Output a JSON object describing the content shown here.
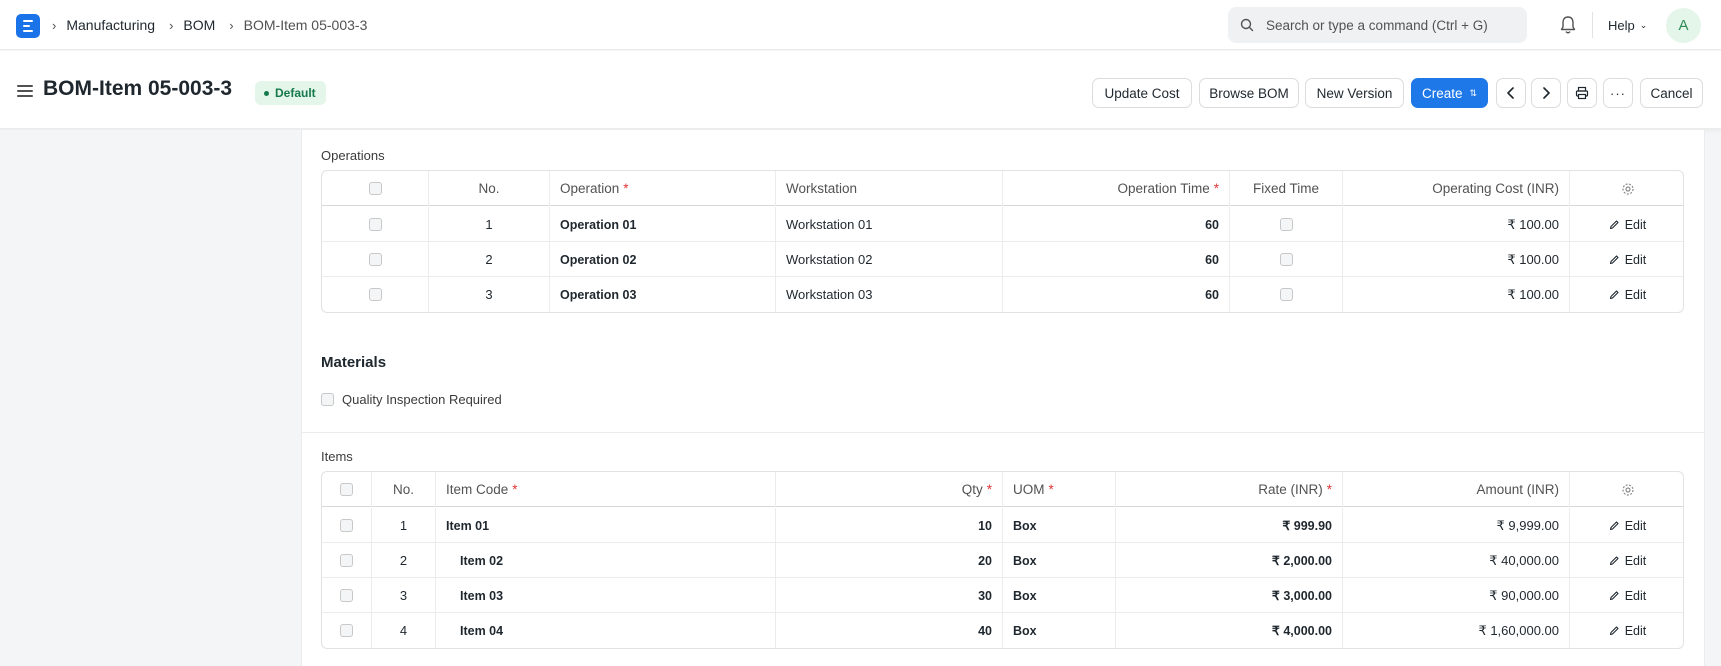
{
  "navbar": {
    "breadcrumbs": [
      "Manufacturing",
      "BOM",
      "BOM-Item 05-003-3"
    ],
    "search_placeholder": "Search or type a command (Ctrl + G)",
    "help_label": "Help",
    "avatar_initial": "A"
  },
  "header": {
    "title": "BOM-Item 05-003-3",
    "status_badge": "Default",
    "buttons": {
      "update_cost": "Update Cost",
      "browse_bom": "Browse BOM",
      "new_version": "New Version",
      "create": "Create",
      "cancel": "Cancel"
    },
    "accent_color": "#1f78e8"
  },
  "operations": {
    "label": "Operations",
    "columns": [
      "No.",
      "Operation",
      "Workstation",
      "Operation Time",
      "Fixed Time",
      "Operating Cost (INR)"
    ],
    "rows": [
      {
        "no": "1",
        "operation": "Operation 01",
        "workstation": "Workstation 01",
        "time": "60",
        "cost": "₹ 100.00"
      },
      {
        "no": "2",
        "operation": "Operation 02",
        "workstation": "Workstation 02",
        "time": "60",
        "cost": "₹ 100.00"
      },
      {
        "no": "3",
        "operation": "Operation 03",
        "workstation": "Workstation 03",
        "time": "60",
        "cost": "₹ 100.00"
      }
    ],
    "edit_label": "Edit"
  },
  "materials": {
    "title": "Materials",
    "quality_inspection_label": "Quality Inspection Required"
  },
  "items": {
    "label": "Items",
    "columns": [
      "No.",
      "Item Code",
      "Qty",
      "UOM",
      "Rate (INR)",
      "Amount (INR)"
    ],
    "rows": [
      {
        "no": "1",
        "code": "Item 01",
        "qty": "10",
        "uom": "Box",
        "rate": "₹ 999.90",
        "amount": "₹ 9,999.00"
      },
      {
        "no": "2",
        "code": "Item 02",
        "qty": "20",
        "uom": "Box",
        "rate": "₹ 2,000.00",
        "amount": "₹ 40,000.00"
      },
      {
        "no": "3",
        "code": "Item 03",
        "qty": "30",
        "uom": "Box",
        "rate": "₹ 3,000.00",
        "amount": "₹ 90,000.00"
      },
      {
        "no": "4",
        "code": "Item 04",
        "qty": "40",
        "uom": "Box",
        "rate": "₹ 4,000.00",
        "amount": "₹ 1,60,000.00"
      }
    ],
    "edit_label": "Edit"
  }
}
